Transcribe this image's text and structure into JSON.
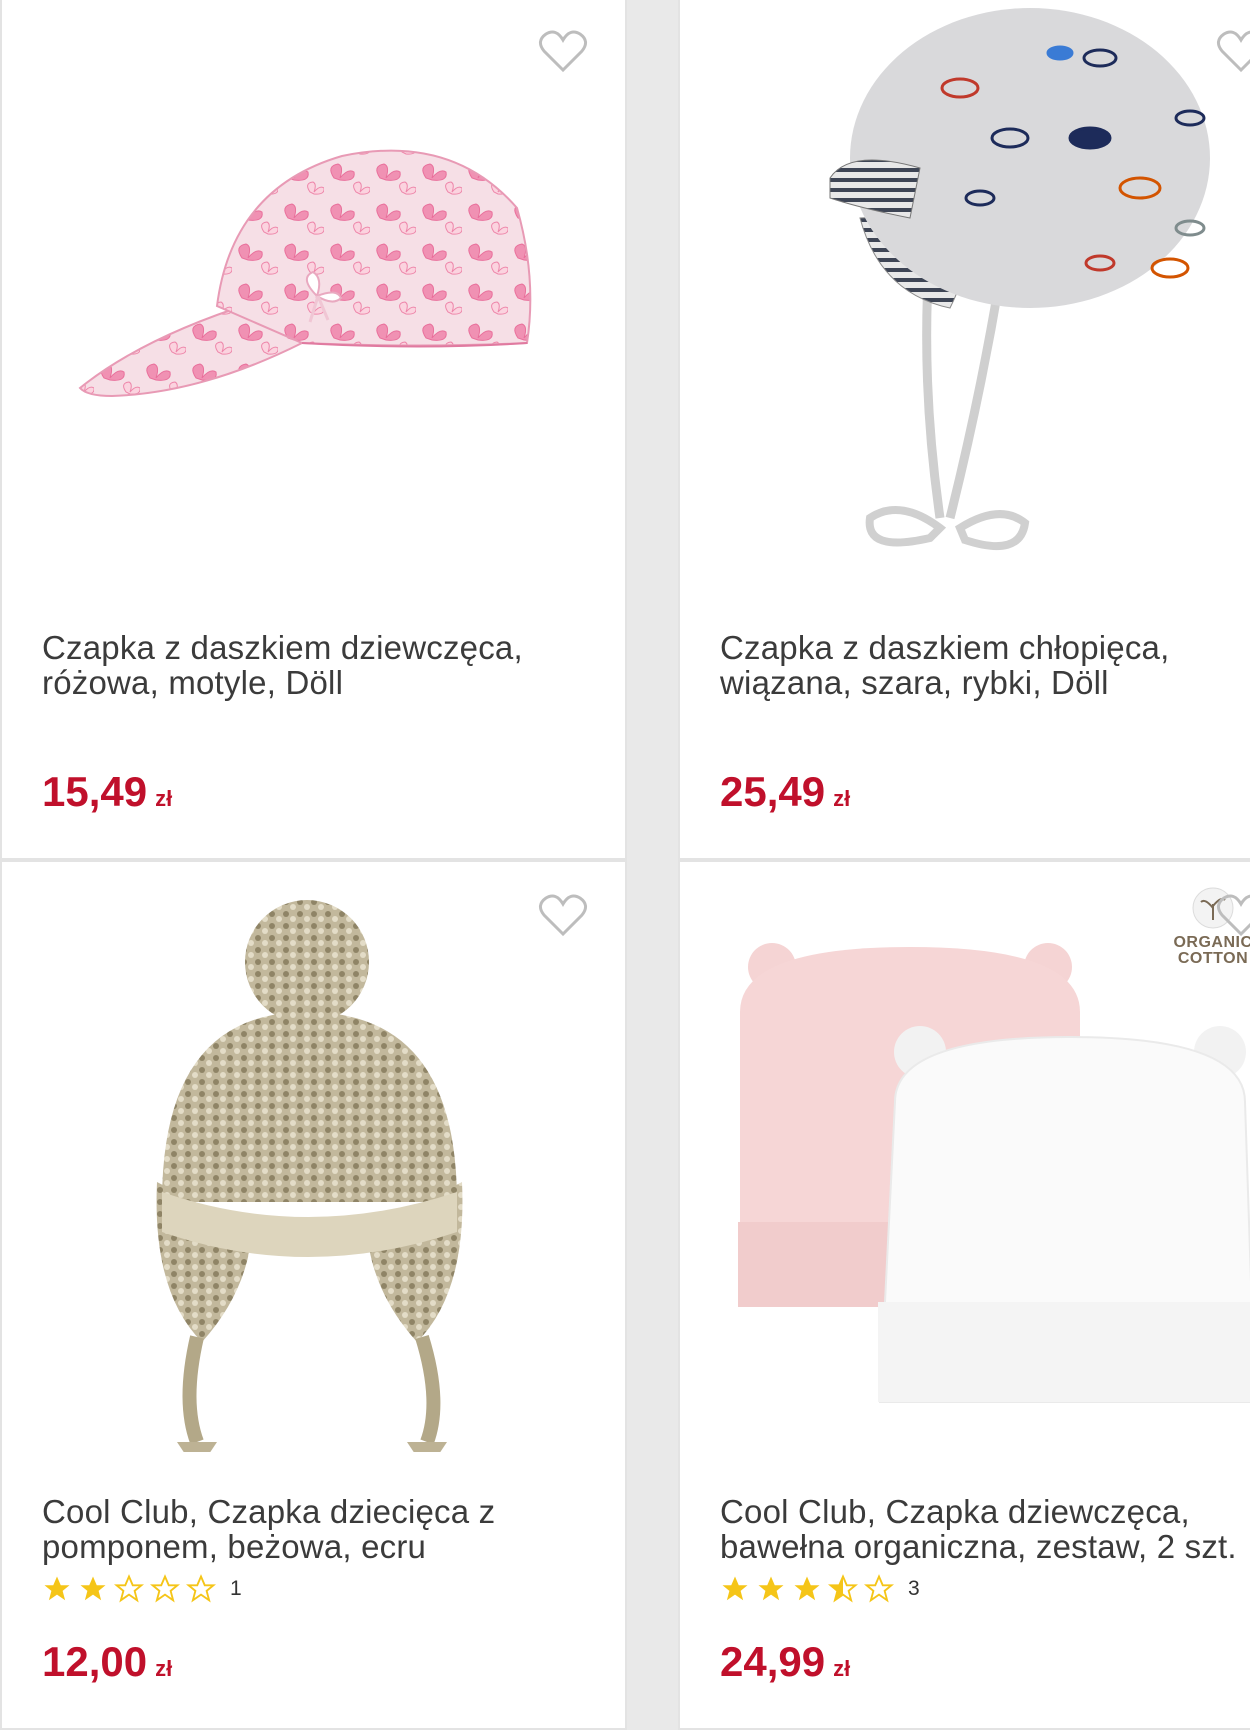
{
  "products": [
    {
      "title": "Czapka z daszkiem dziewczęca, różowa, motyle, Döll",
      "price": "15,49",
      "currency": "zł",
      "image_icon": "pink-butterfly-cap-image"
    },
    {
      "title": "Czapka z daszkiem chłopięca, wiązana, szara, rybki, Döll",
      "price": "25,49",
      "currency": "zł",
      "image_icon": "grey-fish-tie-cap-image"
    },
    {
      "title": "Cool Club, Czapka dziecięca z pomponem, beżowa, ecru",
      "price": "12,00",
      "currency": "zł",
      "rating": 2,
      "rating_max": 5,
      "review_count": "1",
      "image_icon": "beige-pompom-knit-hat-image"
    },
    {
      "title": "Cool Club, Czapka dziewczęca, bawełna organiczna, zestaw, 2 szt.",
      "price": "24,99",
      "currency": "zł",
      "rating": 3.5,
      "rating_max": 5,
      "review_count": "3",
      "badge": [
        "ORGANIC",
        "COTTON"
      ],
      "image_icon": "pink-white-ear-beanies-image"
    }
  ],
  "colors": {
    "price": "#c0102b",
    "star": "#f5c518",
    "heart": "#bdbdbd"
  }
}
